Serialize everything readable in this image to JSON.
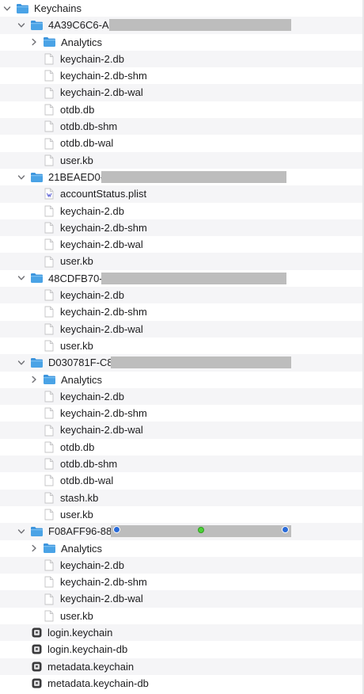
{
  "colors": {
    "folder": "#4aa3e6",
    "stripe": "#f5f5f7",
    "redaction": "#bdbdbd",
    "handle_blue": "#2a6bd8",
    "handle_green": "#4cd137"
  },
  "tree": [
    {
      "label": "Keychains",
      "icon": "folder-icon",
      "level": 0,
      "disclosure": "expanded"
    },
    {
      "label": "4A39C6C6-A",
      "icon": "folder-icon",
      "level": 1,
      "disclosure": "expanded",
      "redacted": true
    },
    {
      "label": "Analytics",
      "icon": "folder-icon",
      "level": 2,
      "disclosure": "collapsed"
    },
    {
      "label": "keychain-2.db",
      "icon": "file-icon",
      "level": 2
    },
    {
      "label": "keychain-2.db-shm",
      "icon": "file-icon",
      "level": 2
    },
    {
      "label": "keychain-2.db-wal",
      "icon": "file-icon",
      "level": 2
    },
    {
      "label": "otdb.db",
      "icon": "file-icon",
      "level": 2
    },
    {
      "label": "otdb.db-shm",
      "icon": "file-icon",
      "level": 2
    },
    {
      "label": "otdb.db-wal",
      "icon": "file-icon",
      "level": 2
    },
    {
      "label": "user.kb",
      "icon": "file-icon",
      "level": 2
    },
    {
      "label": "21BEAED0-D",
      "icon": "folder-icon",
      "level": 1,
      "disclosure": "expanded",
      "redacted": true
    },
    {
      "label": "accountStatus.plist",
      "icon": "plist-file-icon",
      "level": 2
    },
    {
      "label": "keychain-2.db",
      "icon": "file-icon",
      "level": 2
    },
    {
      "label": "keychain-2.db-shm",
      "icon": "file-icon",
      "level": 2
    },
    {
      "label": "keychain-2.db-wal",
      "icon": "file-icon",
      "level": 2
    },
    {
      "label": "user.kb",
      "icon": "file-icon",
      "level": 2
    },
    {
      "label": "48CDFB70-",
      "icon": "folder-icon",
      "level": 1,
      "disclosure": "expanded",
      "redacted": true
    },
    {
      "label": "keychain-2.db",
      "icon": "file-icon",
      "level": 2
    },
    {
      "label": "keychain-2.db-shm",
      "icon": "file-icon",
      "level": 2
    },
    {
      "label": "keychain-2.db-wal",
      "icon": "file-icon",
      "level": 2
    },
    {
      "label": "user.kb",
      "icon": "file-icon",
      "level": 2
    },
    {
      "label": "D030781F-C8",
      "icon": "folder-icon",
      "level": 1,
      "disclosure": "expanded",
      "redacted": true
    },
    {
      "label": "Analytics",
      "icon": "folder-icon",
      "level": 2,
      "disclosure": "collapsed"
    },
    {
      "label": "keychain-2.db",
      "icon": "file-icon",
      "level": 2
    },
    {
      "label": "keychain-2.db-shm",
      "icon": "file-icon",
      "level": 2
    },
    {
      "label": "keychain-2.db-wal",
      "icon": "file-icon",
      "level": 2
    },
    {
      "label": "otdb.db",
      "icon": "file-icon",
      "level": 2
    },
    {
      "label": "otdb.db-shm",
      "icon": "file-icon",
      "level": 2
    },
    {
      "label": "otdb.db-wal",
      "icon": "file-icon",
      "level": 2
    },
    {
      "label": "stash.kb",
      "icon": "file-icon",
      "level": 2
    },
    {
      "label": "user.kb",
      "icon": "file-icon",
      "level": 2
    },
    {
      "label": "F08AFF96-88",
      "icon": "folder-icon",
      "level": 1,
      "disclosure": "expanded",
      "redacted": true,
      "selection_handles": true
    },
    {
      "label": "Analytics",
      "icon": "folder-icon",
      "level": 2,
      "disclosure": "collapsed"
    },
    {
      "label": "keychain-2.db",
      "icon": "file-icon",
      "level": 2
    },
    {
      "label": "keychain-2.db-shm",
      "icon": "file-icon",
      "level": 2
    },
    {
      "label": "keychain-2.db-wal",
      "icon": "file-icon",
      "level": 2
    },
    {
      "label": "user.kb",
      "icon": "file-icon",
      "level": 2
    },
    {
      "label": "login.keychain",
      "icon": "keychain-file-icon",
      "level": 1
    },
    {
      "label": "login.keychain-db",
      "icon": "keychain-file-icon",
      "level": 1
    },
    {
      "label": "metadata.keychain",
      "icon": "keychain-file-icon",
      "level": 1
    },
    {
      "label": "metadata.keychain-db",
      "icon": "keychain-file-icon",
      "level": 1
    }
  ]
}
